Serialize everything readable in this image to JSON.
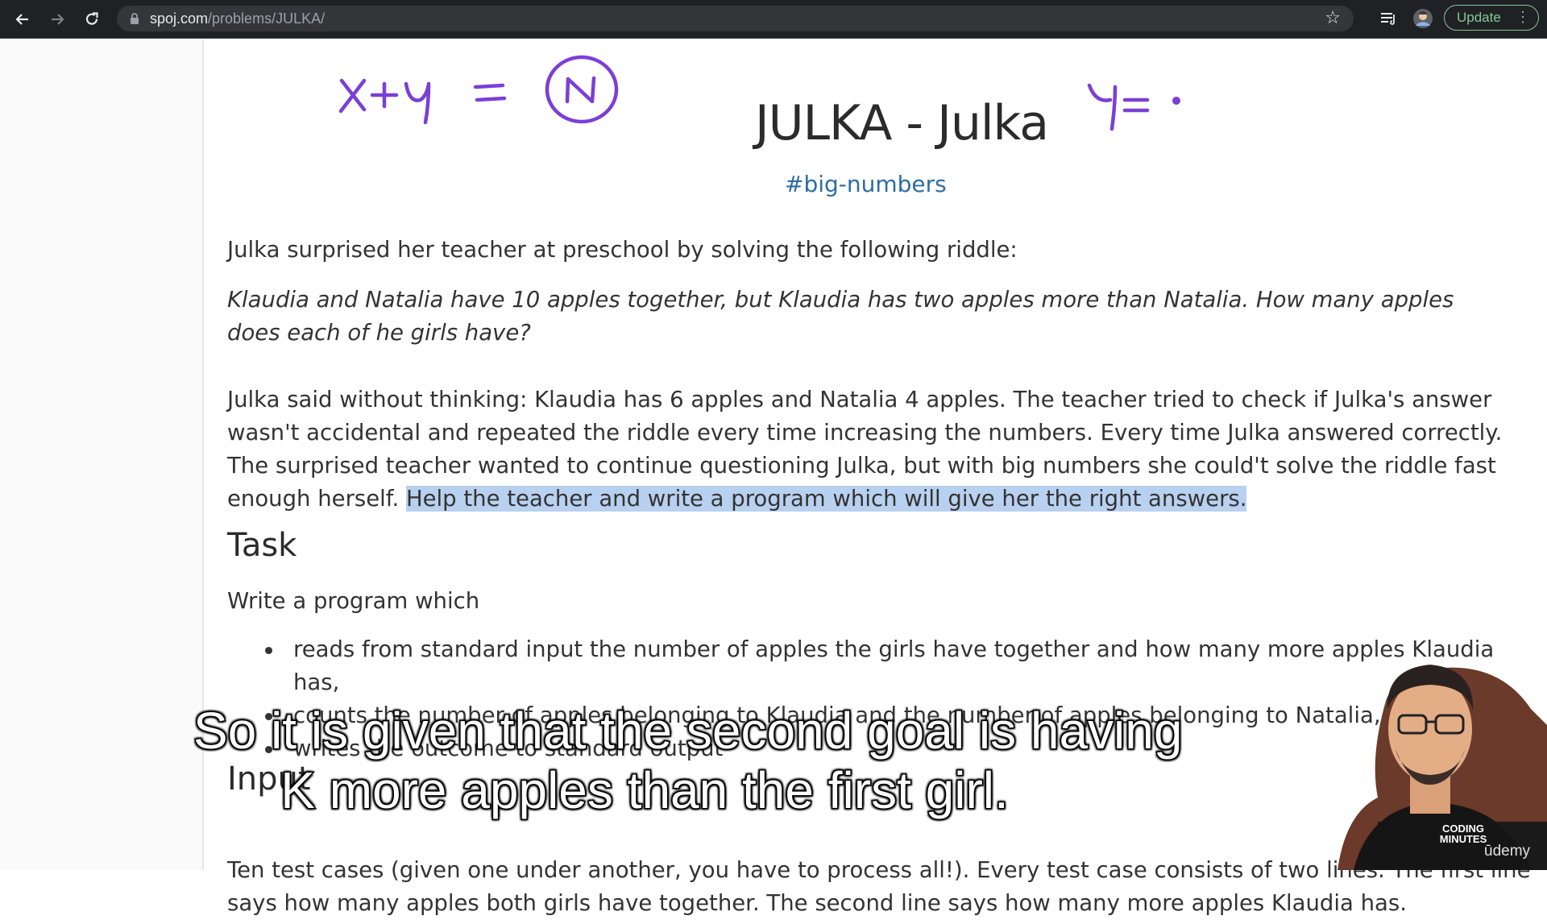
{
  "browser": {
    "url_host": "spoj.com",
    "url_path": "/problems/JULKA/",
    "update_label": "Update",
    "icons": {
      "back": "back-arrow-icon",
      "forward": "forward-arrow-icon",
      "reload": "reload-icon",
      "lock": "lock-icon",
      "star": "bookmark-star-icon",
      "reading_list": "reading-list-icon",
      "profile": "profile-avatar-icon",
      "menu": "kebab-menu-icon"
    },
    "colors": {
      "chrome_bg": "#202124",
      "omnibox_bg": "#35363a",
      "update_accent": "#81c995"
    }
  },
  "problem": {
    "title": "JULKA - Julka",
    "tag": "#big-numbers",
    "intro": "Julka surprised her teacher at preschool by solving the following riddle:",
    "riddle": "Klaudia and Natalia have 10 apples together, but Klaudia has two apples more than Natalia. How many apples does each of he girls have?",
    "story_plain": "Julka said without thinking: Klaudia has 6 apples and Natalia 4 apples. The teacher tried to check if Julka's answer wasn't accidental and repeated the riddle every time increasing the numbers. Every time Julka answered correctly. The surprised teacher wanted to continue questioning Julka, but with big numbers she could't solve the riddle fast enough herself. ",
    "story_highlight": "Help the teacher and write a program which will give her the right answers.",
    "task_heading": "Task",
    "task_intro": "Write a program which",
    "task_items": [
      "reads from standard input the number of apples the girls have together and how many more apples Klaudia has,",
      "counts the number of apples belonging to Klaudia and the number of apples belonging to Natalia,",
      "writes the outcome to standard output"
    ],
    "input_heading": "Input",
    "input_line1": "Ten test cases (given one under another, you have to process all!). Every test case consists of two lines. The first line",
    "input_line2": "says how many apples both girls have together. The second line says how many more apples Klaudia has."
  },
  "annotations": {
    "left": "x+y  =  N",
    "right": "Y = .",
    "ink_color": "#7b3fd6"
  },
  "video": {
    "subtitle_line1": "So it is given that the second goal is having",
    "subtitle_line2": "K more apples than the first girl.",
    "channel_logo": "CODING MINUTES",
    "platform": "ūdemy"
  }
}
